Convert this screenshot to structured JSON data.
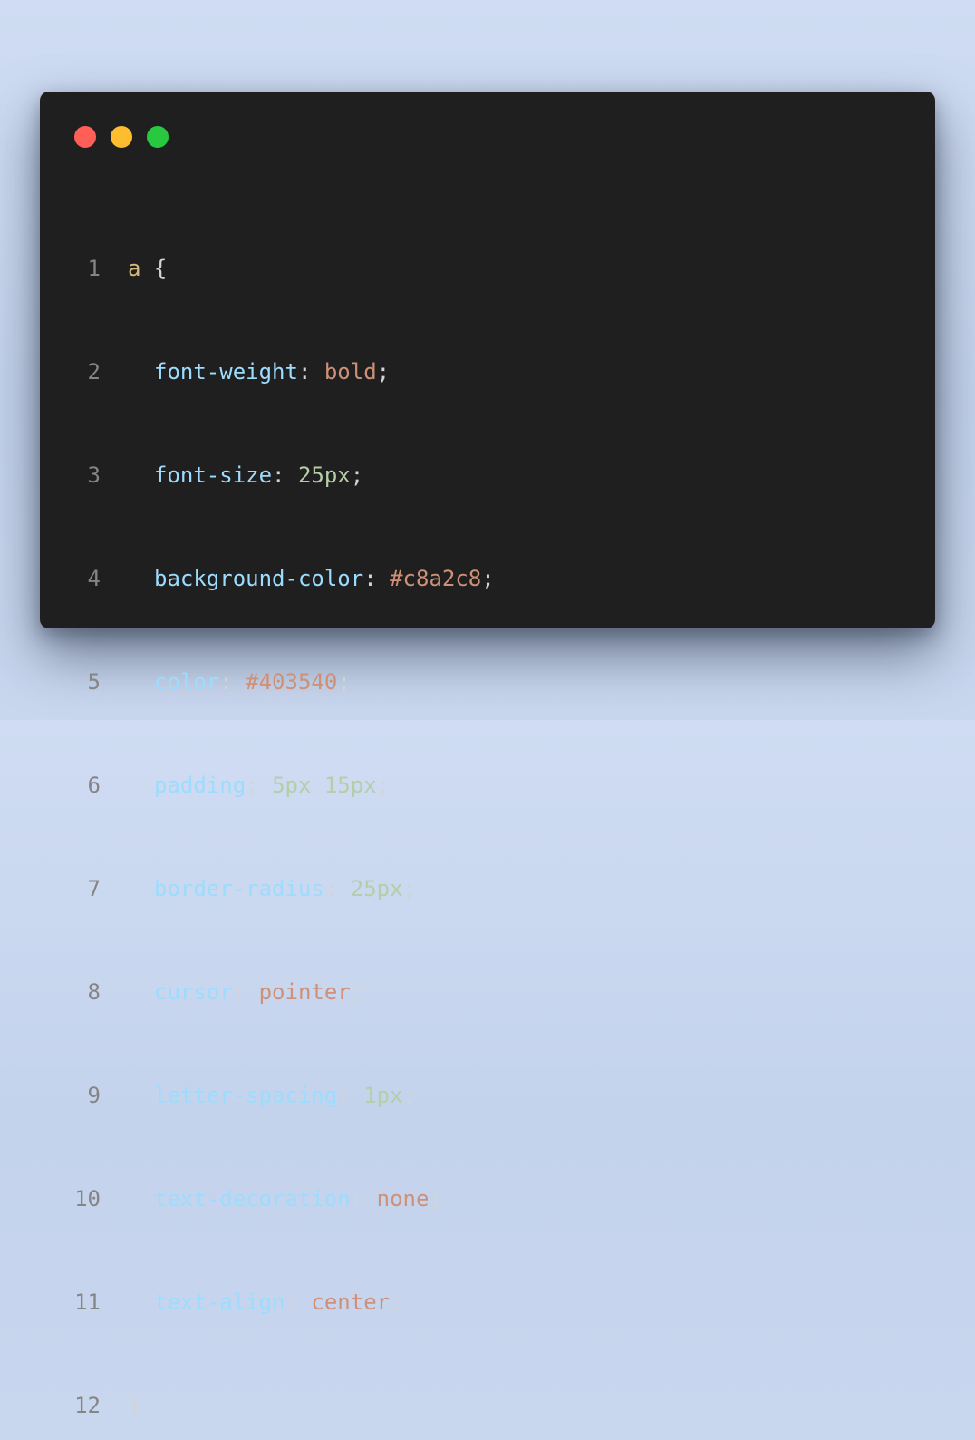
{
  "window_controls": {
    "close_color": "#ff5f57",
    "minimize_color": "#febc2e",
    "maximize_color": "#28c840"
  },
  "colors": {
    "background": "#c8d6ee",
    "editor": "#1f1f1f",
    "line_number": "#858585",
    "selector": "#d7ba7d",
    "property": "#9cdcfe",
    "keyword_value": "#ce9178",
    "number_value": "#b5cea8",
    "punctuation": "#d4d4d4"
  },
  "code": {
    "line1": {
      "num": "1",
      "selector": "a",
      "brace": "{"
    },
    "line2": {
      "num": "2",
      "prop": "font-weight",
      "value": "bold"
    },
    "line3": {
      "num": "3",
      "prop": "font-size",
      "value": "25px"
    },
    "line4": {
      "num": "4",
      "prop": "background-color",
      "value": "#c8a2c8"
    },
    "line5": {
      "num": "5",
      "prop": "color",
      "value": "#403540"
    },
    "line6": {
      "num": "6",
      "prop": "padding",
      "value": "5px 15px"
    },
    "line7": {
      "num": "7",
      "prop": "border-radius",
      "value": "25px"
    },
    "line8": {
      "num": "8",
      "prop": "cursor",
      "value": "pointer"
    },
    "line9": {
      "num": "9",
      "prop": "letter-spacing",
      "value": "1px"
    },
    "line10": {
      "num": "10",
      "prop": "text-decoration",
      "value": "none"
    },
    "line11": {
      "num": "11",
      "prop": "text-align",
      "value": "center"
    },
    "line12": {
      "num": "12",
      "brace": "}"
    }
  }
}
